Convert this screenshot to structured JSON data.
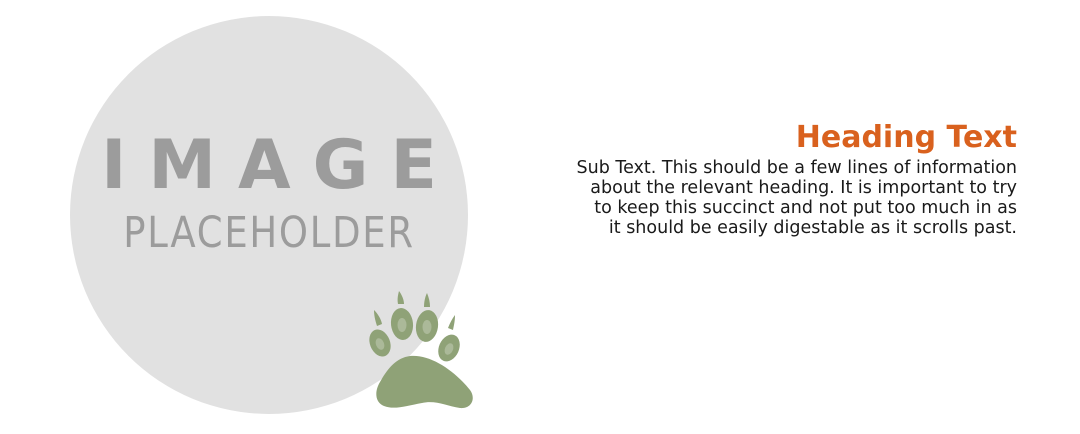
{
  "image": {
    "word_1": "IMAGE",
    "word_2": "PLACEHOLDER",
    "circle_color": "#e1e1e1",
    "text_color": "#9c9c9c",
    "paw_color": "#8fa277",
    "icon": "paw-print-icon"
  },
  "content": {
    "heading": "Heading Text",
    "heading_color": "#d9611e",
    "subtext_lines": [
      "Sub Text. This should be a few lines of information",
      "about the relevant heading. It is important to try",
      "to keep this succinct and not put too much in as",
      "it should be easily digestable as it scrolls past."
    ]
  }
}
